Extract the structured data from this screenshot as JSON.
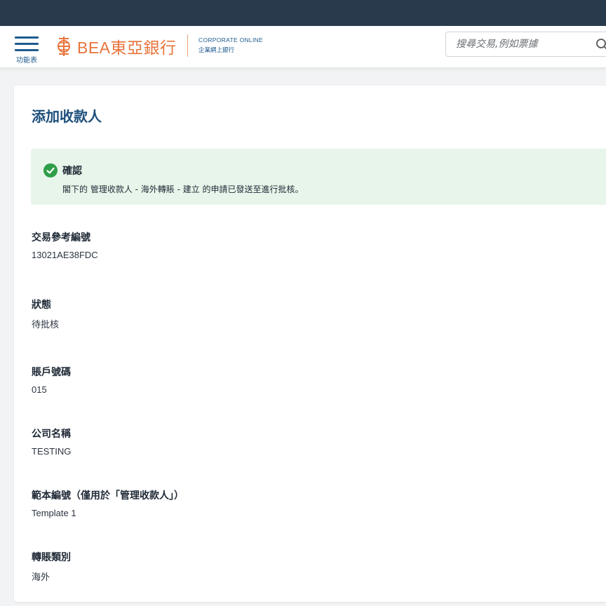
{
  "header": {
    "menu_label": "功能表",
    "brand_name": "BEA東亞銀行",
    "corporate_en": "CORPORATE ONLINE",
    "corporate_zh": "企業網上銀行",
    "search_placeholder": "搜尋交易,例如票據"
  },
  "colors": {
    "topbar": "#2a3a4d",
    "accent": "#1d5b8f",
    "brand": "#e8743b",
    "success": "#2e9e48",
    "success_bg": "#e8f5ea"
  },
  "page": {
    "title": "添加收款人"
  },
  "alert": {
    "icon": "check-circle-icon",
    "title": "確認",
    "message": "閣下的 管理收款人 - 海外轉賬 - 建立 的申請已發送至進行批核。"
  },
  "fields": [
    {
      "label": "交易參考編號",
      "value": "13021AE38FDC"
    },
    {
      "label": "狀態",
      "value": "待批核"
    },
    {
      "label": "賬戶號碼",
      "value": "015"
    },
    {
      "label": "公司名稱",
      "value": "TESTING"
    },
    {
      "label": "範本編號（僅用於「管理收款人」）",
      "value": "Template 1"
    },
    {
      "label": "轉賬類別",
      "value": "海外"
    }
  ]
}
